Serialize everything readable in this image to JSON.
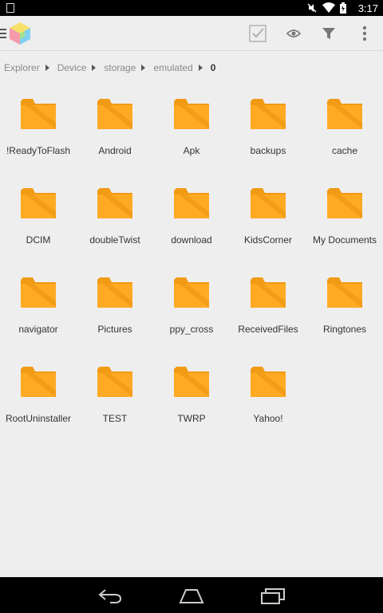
{
  "status": {
    "time": "3:17"
  },
  "breadcrumb": [
    {
      "label": "Explorer"
    },
    {
      "label": "Device"
    },
    {
      "label": "storage"
    },
    {
      "label": "emulated"
    },
    {
      "label": "0"
    }
  ],
  "toolbar": {
    "icons": [
      "select-checkbox-icon",
      "eye-icon",
      "filter-icon",
      "overflow-menu-icon"
    ]
  },
  "folders": [
    {
      "name": "!ReadyToFlash"
    },
    {
      "name": "Android"
    },
    {
      "name": "Apk"
    },
    {
      "name": "backups"
    },
    {
      "name": "cache"
    },
    {
      "name": "DCIM"
    },
    {
      "name": "doubleTwist"
    },
    {
      "name": "download"
    },
    {
      "name": "KidsCorner"
    },
    {
      "name": "My Documents"
    },
    {
      "name": "navigator"
    },
    {
      "name": "Pictures"
    },
    {
      "name": "ppy_cross"
    },
    {
      "name": "ReceivedFiles"
    },
    {
      "name": "Ringtones"
    },
    {
      "name": "RootUninstaller"
    },
    {
      "name": "TEST"
    },
    {
      "name": "TWRP"
    },
    {
      "name": "Yahoo!"
    }
  ],
  "colors": {
    "folder_back": "#f19a14",
    "folder_front": "#ffaa22",
    "folder_shade": "#d9820c",
    "background": "#eeeeee"
  }
}
